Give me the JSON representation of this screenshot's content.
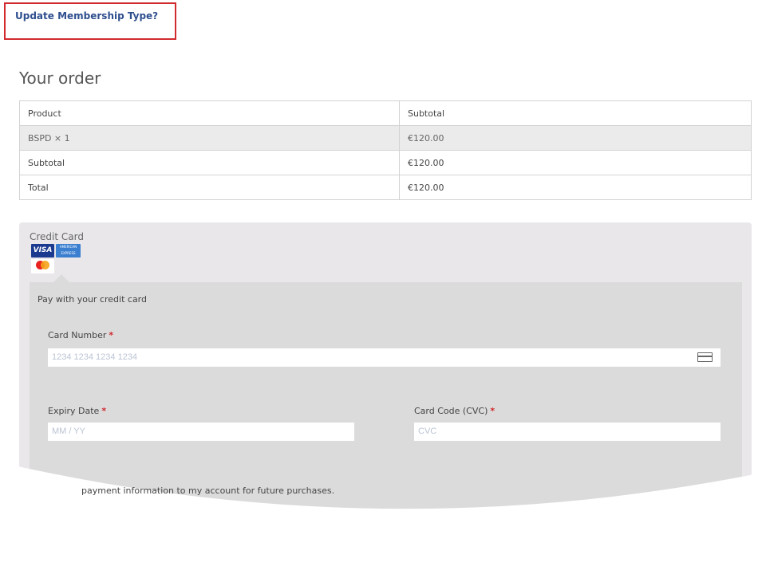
{
  "membership": {
    "update_link": "Update Membership Type?"
  },
  "order": {
    "heading": "Your order",
    "columns": [
      "Product",
      "Subtotal"
    ],
    "rows": [
      {
        "label": "BSPD  × 1",
        "value": "€120.00"
      },
      {
        "label": "Subtotal",
        "value": "€120.00"
      },
      {
        "label": "Total",
        "value": "€120.00"
      }
    ]
  },
  "payment": {
    "method_label": "Credit Card",
    "card_logos": {
      "visa": "VISA",
      "amex": "AMERICAN EXPRESS",
      "mastercard": "mastercard"
    },
    "description": "Pay with your credit card",
    "card_number": {
      "label": "Card Number",
      "placeholder": "1234 1234 1234 1234"
    },
    "expiry": {
      "label": "Expiry Date",
      "placeholder": "MM / YY"
    },
    "cvc": {
      "label": "Card Code (CVC)",
      "placeholder": "CVC"
    },
    "required_mark": "*",
    "save_info_text": "payment information to my account for future purchases."
  },
  "colors": {
    "link": "#2f4f8f",
    "highlight_border": "#d02a2e",
    "required": "#d0262a",
    "panel": "#e9e7ea",
    "inner_panel": "#dcdbdc"
  }
}
